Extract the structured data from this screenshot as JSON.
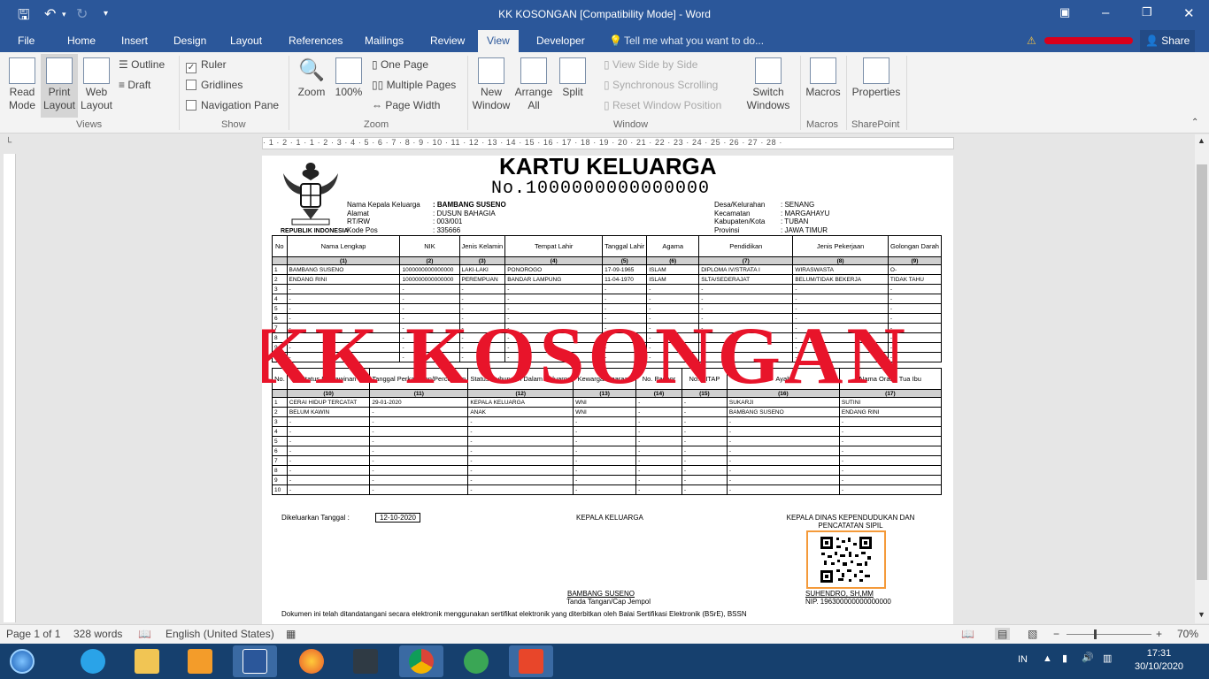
{
  "window": {
    "title": "KK KOSONGAN [Compatibility Mode] - Word",
    "share": "Share",
    "tell": "Tell me what you want to do..."
  },
  "tabs": [
    "File",
    "Home",
    "Insert",
    "Design",
    "Layout",
    "References",
    "Mailings",
    "Review",
    "View",
    "Developer"
  ],
  "ribbon": {
    "views": {
      "label": "Views",
      "read": "Read\nMode",
      "print": "Print\nLayout",
      "web": "Web\nLayout",
      "outline": "Outline",
      "draft": "Draft"
    },
    "show": {
      "label": "Show",
      "ruler": "Ruler",
      "gridlines": "Gridlines",
      "nav": "Navigation Pane"
    },
    "zoom": {
      "label": "Zoom",
      "zoom": "Zoom",
      "pct": "100%",
      "one": "One Page",
      "multi": "Multiple Pages",
      "width": "Page Width"
    },
    "window": {
      "label": "Window",
      "new": "New\nWindow",
      "arrange": "Arrange\nAll",
      "split": "Split",
      "side": "View Side by Side",
      "sync": "Synchronous Scrolling",
      "reset": "Reset Window Position",
      "switch": "Switch\nWindows"
    },
    "macros": {
      "label": "Macros",
      "macros": "Macros"
    },
    "sharepoint": {
      "label": "SharePoint",
      "props": "Properties"
    }
  },
  "ruler": "· 1 · 2 · 1 · 1 · 2 · 3 · 4 · 5 · 6 · 7 · 8 · 9 · 10 · 11 · 12 · 13 · 14 · 15 · 16 · 17 · 18 · 19 · 20 · 21 · 22 · 23 · 24 · 25 · 26 · 27 · 28 ·",
  "doc": {
    "title": "KARTU KELUARGA",
    "no": "No.1000000000000000",
    "emblem_caption": "REPUBLIK INDONESIA",
    "left_info": [
      [
        "Nama Kepala Keluarga",
        ": BAMBANG SUSENO"
      ],
      [
        "Alamat",
        ": DUSUN BAHAGIA"
      ],
      [
        "RT/RW",
        ": 003/001"
      ],
      [
        "Kode Pos",
        ": 335666"
      ]
    ],
    "right_info": [
      [
        "Desa/Kelurahan",
        ": SENANG"
      ],
      [
        "Kecamatan",
        ": MARGAHAYU"
      ],
      [
        "Kabupaten/Kota",
        ": TUBAN"
      ],
      [
        "Provinsi",
        ": JAWA TIMUR"
      ]
    ],
    "t1_headers": [
      "No",
      "Nama Lengkap",
      "NIK",
      "Jenis Kelamin",
      "Tempat Lahir",
      "Tanggal Lahir",
      "Agama",
      "Pendidikan",
      "Jenis Pekerjaan",
      "Golongan Darah"
    ],
    "t1_nums": [
      "",
      "(1)",
      "(2)",
      "(3)",
      "(4)",
      "(5)",
      "(6)",
      "(7)",
      "(8)",
      "(9)"
    ],
    "t1_rows": [
      [
        "1",
        "BAMBANG SUSENO",
        "1000000000000000",
        "LAKI-LAKI",
        "PONOROGO",
        "17-09-1965",
        "ISLAM",
        "DIPLOMA IV/STRATA I",
        "WIRASWASTA",
        "O-"
      ],
      [
        "2",
        "ENDANG RINI",
        "1000000000000000",
        "PEREMPUAN",
        "BANDAR LAMPUNG",
        "11-04-1970",
        "ISLAM",
        "SLTA/SEDERAJAT",
        "BELUM/TIDAK BEKERJA",
        "TIDAK TAHU"
      ],
      [
        "3",
        "-",
        "-",
        "-",
        "-",
        "-",
        "-",
        "-",
        "-",
        "-"
      ],
      [
        "4",
        "-",
        "-",
        "-",
        "-",
        "-",
        "-",
        "-",
        "-",
        "-"
      ],
      [
        "5",
        "-",
        "-",
        "-",
        "-",
        "-",
        "-",
        "-",
        "-",
        "-"
      ],
      [
        "6",
        "-",
        "-",
        "-",
        "-",
        "-",
        "-",
        "-",
        "-",
        "-"
      ],
      [
        "7",
        "-",
        "-",
        "-",
        "-",
        "-",
        "-",
        "-",
        "-",
        "-"
      ],
      [
        "8",
        "-",
        "-",
        "-",
        "-",
        "-",
        "-",
        "-",
        "-",
        "-"
      ],
      [
        "9",
        "-",
        "-",
        "-",
        "-",
        "-",
        "-",
        "-",
        "-",
        "-"
      ],
      [
        "10",
        "-",
        "-",
        "-",
        "-",
        "-",
        "-",
        "-",
        "-",
        "-"
      ]
    ],
    "t2_headers": [
      "No.",
      "Status Perkawinan",
      "Tanggal Perkawinan/Perceraian",
      "Status Hubungan Dalam Keluarga",
      "Kewarganegaraan",
      "No. Paspor",
      "No. KITAP",
      "Ayah",
      "Nama Orang Tua Ibu"
    ],
    "t2_nums": [
      "",
      "(10)",
      "(11)",
      "(12)",
      "(13)",
      "(14)",
      "(15)",
      "(16)",
      "(17)"
    ],
    "t2_rows": [
      [
        "1",
        "CERAI HIDUP TERCATAT",
        "29-01-2020",
        "KEPALA KELUARGA",
        "WNI",
        "-",
        "-",
        "SUKARJI",
        "SUTINI"
      ],
      [
        "2",
        "BELUM KAWIN",
        "-",
        "ANAK",
        "WNI",
        "-",
        "-",
        "BAMBANG SUSENO",
        "ENDANG RINI"
      ],
      [
        "3",
        "-",
        "-",
        "-",
        "-",
        "-",
        "-",
        "-",
        "-"
      ],
      [
        "4",
        "-",
        "-",
        "-",
        "-",
        "-",
        "-",
        "-",
        "-"
      ],
      [
        "5",
        "-",
        "-",
        "-",
        "-",
        "-",
        "-",
        "-",
        "-"
      ],
      [
        "6",
        "-",
        "-",
        "-",
        "-",
        "-",
        "-",
        "-",
        "-"
      ],
      [
        "7",
        "-",
        "-",
        "-",
        "-",
        "-",
        "-",
        "-",
        "-"
      ],
      [
        "8",
        "-",
        "-",
        "-",
        "-",
        "-",
        "-",
        "-",
        "-"
      ],
      [
        "9",
        "-",
        "-",
        "-",
        "-",
        "-",
        "-",
        "-",
        "-"
      ],
      [
        "10",
        "-",
        "-",
        "-",
        "-",
        "-",
        "-",
        "-",
        "-"
      ]
    ],
    "issued_label": "Dikeluarkan Tanggal :",
    "issued_date": "12-10-2020",
    "kepala_label": "KEPALA KELUARGA",
    "kepala_name": "BAMBANG SUSENO",
    "kepala_sign": "Tanda Tangan/Cap Jempol",
    "dinas_label": "KEPALA DINAS KEPENDUDUKAN DAN PENCATATAN SIPIL",
    "dinas_name": "SUHENDRO, SH,MM",
    "dinas_nip": "NIP. 196300000000000000",
    "disclaimer": "Dokumen ini telah ditandatangani secara elektronik menggunakan sertifikat elektronik yang diterbitkan oleh Balai Sertifikasi Elektronik (BSrE), BSSN",
    "watermark": "KK KOSONGAN"
  },
  "status": {
    "page": "Page 1 of 1",
    "words": "328 words",
    "lang": "English (United States)",
    "zoom": "70%"
  },
  "tray": {
    "lang": "IN",
    "time": "17:31",
    "date": "30/10/2020"
  }
}
